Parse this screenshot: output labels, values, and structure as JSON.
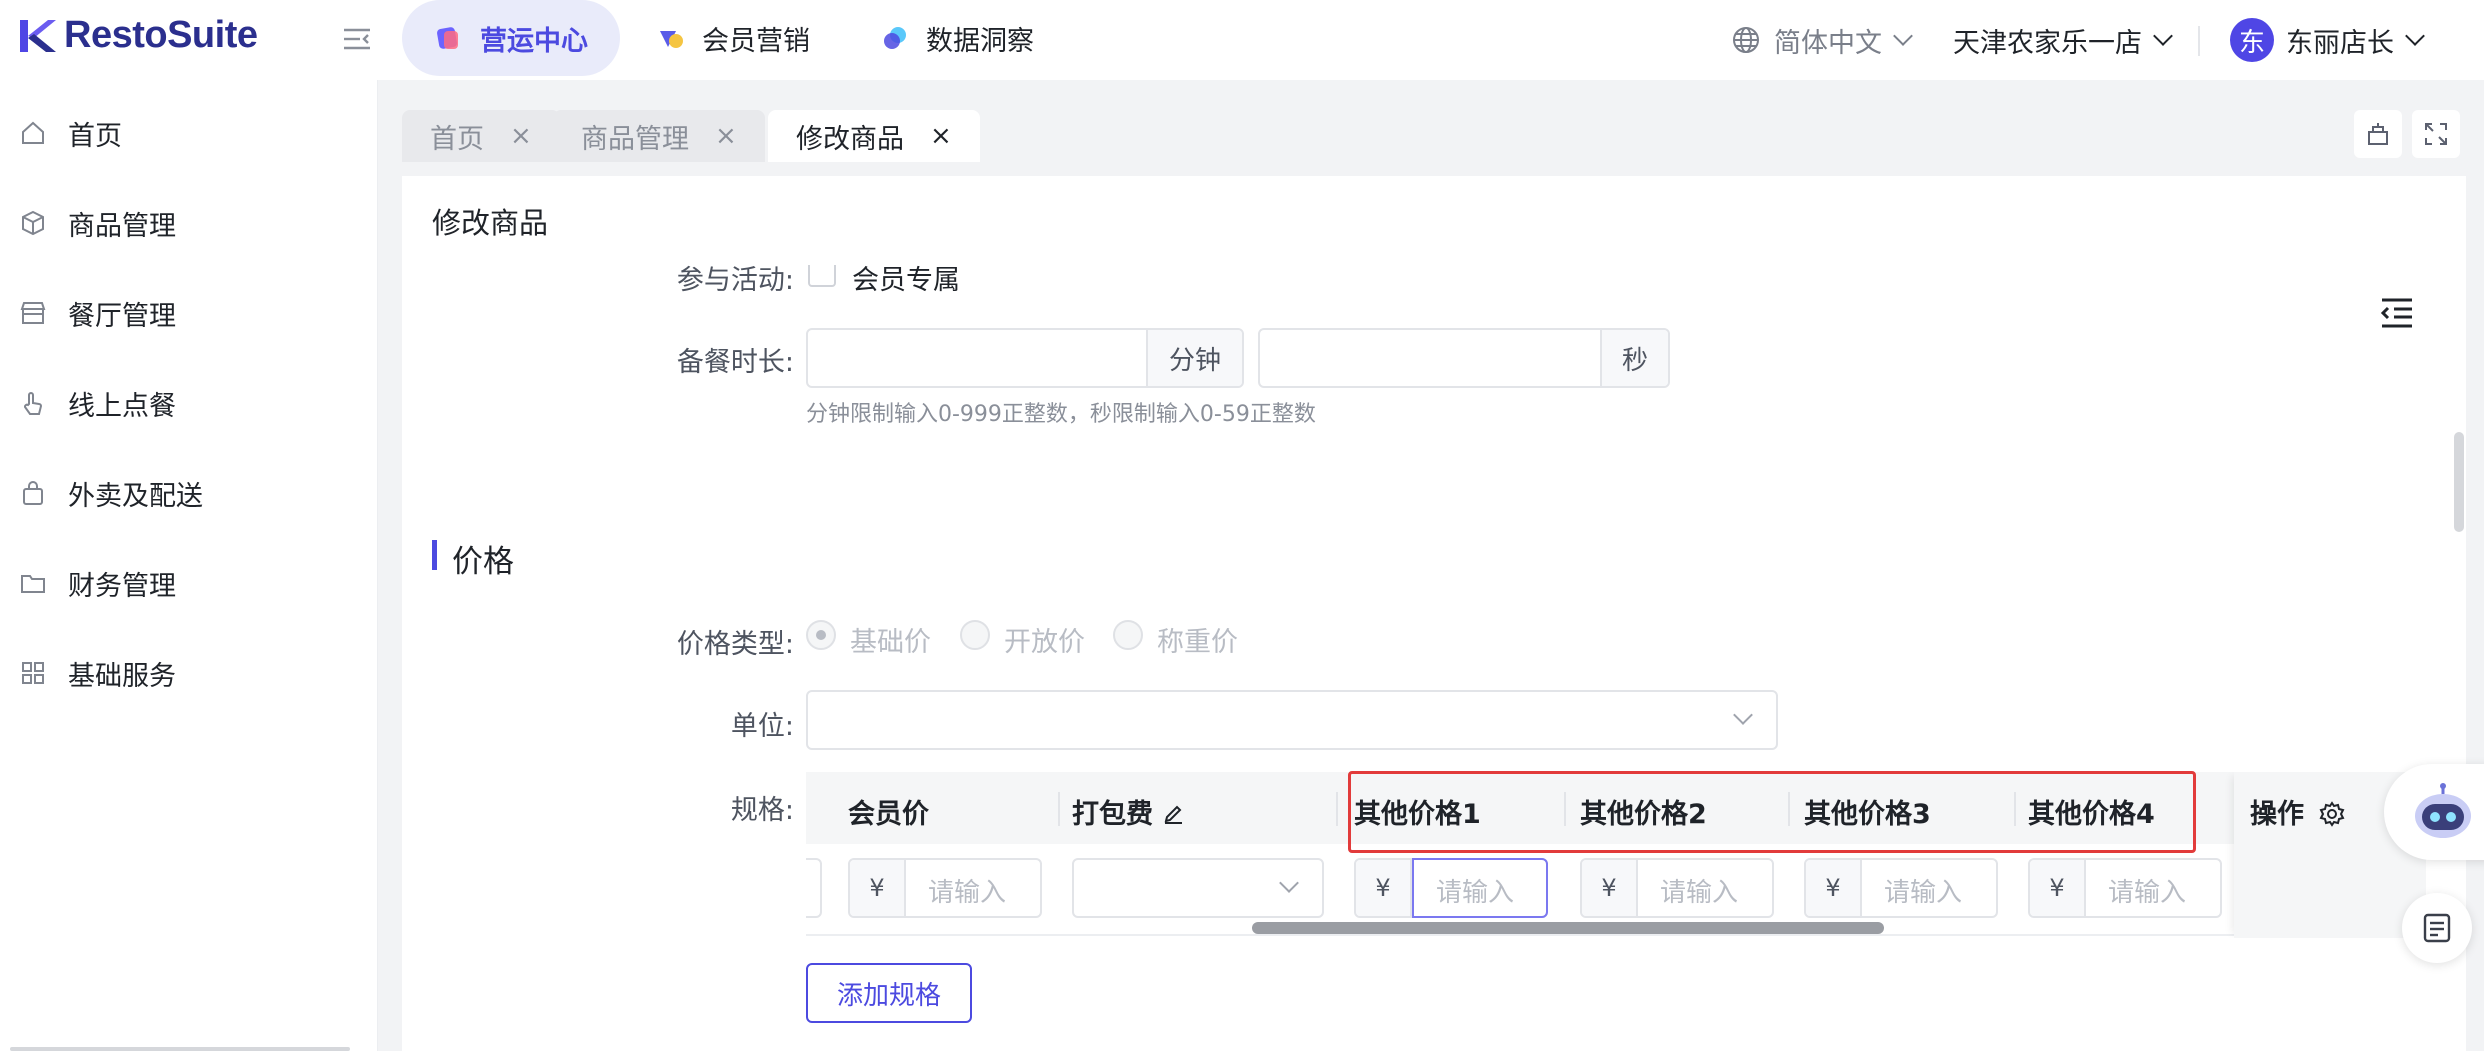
{
  "app": {
    "logo_text": "RestoSuite",
    "brand_color": "#2b2f8e",
    "accent_color": "#4c4ae0"
  },
  "top_nav": {
    "tabs": [
      {
        "label": "营运中心",
        "icon": "operations-icon",
        "active": true
      },
      {
        "label": "会员营销",
        "icon": "member-marketing-icon",
        "active": false
      },
      {
        "label": "数据洞察",
        "icon": "data-insight-icon",
        "active": false
      }
    ],
    "language": "简体中文",
    "store": "天津农家乐一店",
    "avatar_initial": "东",
    "user": "东丽店长"
  },
  "sidebar": {
    "items": [
      {
        "label": "首页",
        "icon": "home-icon"
      },
      {
        "label": "商品管理",
        "icon": "cube-icon"
      },
      {
        "label": "餐厅管理",
        "icon": "store-icon"
      },
      {
        "label": "线上点餐",
        "icon": "tap-icon"
      },
      {
        "label": "外卖及配送",
        "icon": "bag-icon"
      },
      {
        "label": "财务管理",
        "icon": "folder-icon"
      },
      {
        "label": "基础服务",
        "icon": "grid-icon"
      }
    ]
  },
  "page_tabs": [
    {
      "label": "首页",
      "active": false
    },
    {
      "label": "商品管理",
      "active": false
    },
    {
      "label": "修改商品",
      "active": true
    }
  ],
  "close_glyph": "×",
  "card": {
    "title": "修改商品"
  },
  "form": {
    "activity_label": "参与活动:",
    "activity_option": "会员专属",
    "prep_time_label": "备餐时长:",
    "minute_suffix": "分钟",
    "second_suffix": "秒",
    "prep_time_hint": "分钟限制输入0-999正整数，秒限制输入0-59正整数",
    "price_section_title": "价格",
    "price_type_label": "价格类型:",
    "price_types": [
      "基础价",
      "开放价",
      "称重价"
    ],
    "unit_label": "单位:",
    "spec_label": "规格:",
    "add_spec_button": "添加规格"
  },
  "spec_table": {
    "columns": [
      "会员价",
      "打包费",
      "其他价格1",
      "其他价格2",
      "其他价格3",
      "其他价格4",
      "操作"
    ],
    "currency_symbol": "¥",
    "placeholder": "请输入"
  }
}
